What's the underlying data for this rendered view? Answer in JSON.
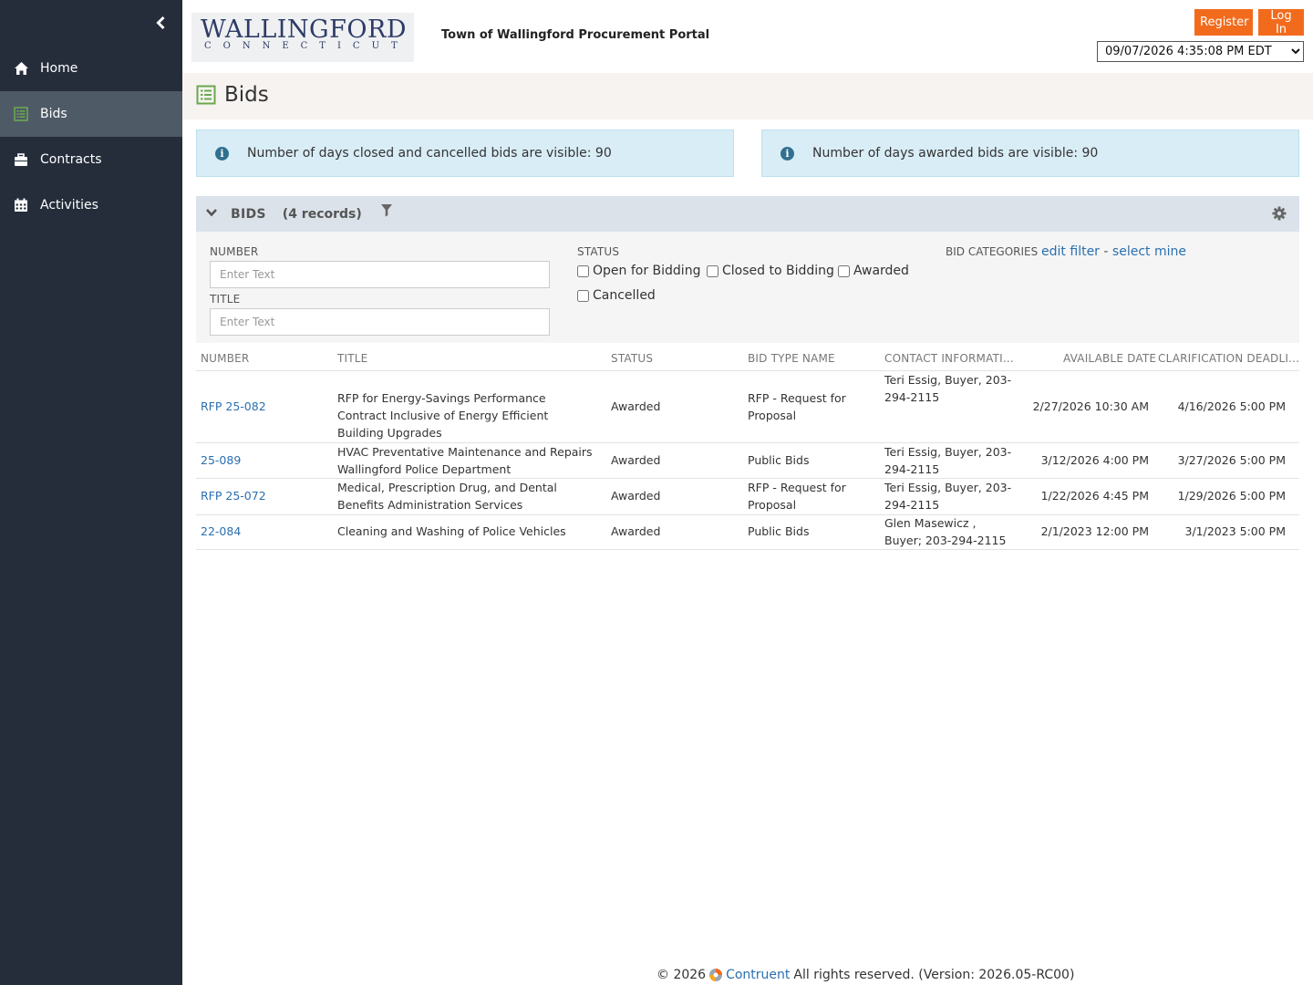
{
  "sidebar": {
    "items": [
      {
        "label": "Home",
        "icon": "home-icon"
      },
      {
        "label": "Bids",
        "icon": "list-icon",
        "active": true
      },
      {
        "label": "Contracts",
        "icon": "briefcase-icon"
      },
      {
        "label": "Activities",
        "icon": "calendar-icon"
      }
    ]
  },
  "header": {
    "logo_main": "WALLINGFORD",
    "logo_sub": "CONNECTICUT",
    "portal_title": "Town of Wallingford Procurement Portal",
    "register_label": "Register",
    "login_label": "Log In",
    "datetime": "09/07/2026 4:35:08 PM  EDT"
  },
  "page": {
    "title": "Bids"
  },
  "info": {
    "closed_cancelled": "Number of days closed and cancelled bids are visible: 90",
    "awarded": "Number of days awarded bids are visible: 90"
  },
  "panel": {
    "label": "BIDS",
    "count": "(4 records)"
  },
  "filters": {
    "number_label": "NUMBER",
    "number_placeholder": "Enter Text",
    "title_label": "TITLE",
    "title_placeholder": "Enter Text",
    "status_label": "STATUS",
    "status_options": [
      "Open for Bidding",
      "Closed to Bidding",
      "Awarded",
      "Cancelled"
    ],
    "bid_categories_label": "BID CATEGORIES",
    "edit_filter": "edit filter",
    "separator": " - ",
    "select_mine": "select mine"
  },
  "table": {
    "headers": [
      "NUMBER",
      "TITLE",
      "STATUS",
      "BID TYPE NAME",
      "CONTACT INFORMATI...",
      "AVAILABLE DATE",
      "CLARIFICATION DEADLI..."
    ],
    "rows": [
      {
        "number": "RFP 25-082",
        "title": "RFP for Energy-Savings Performance Contract Inclusive of Energy Efficient Building Upgrades",
        "status": "Awarded",
        "bid_type": "RFP - Request for Proposal",
        "contact": "Teri Essig, Buyer, 203-294-2115",
        "available": "2/27/2026 10:30 AM",
        "clarification": "4/16/2026 5:00 PM"
      },
      {
        "number": "25-089",
        "title": "HVAC Preventative Maintenance and Repairs Wallingford Police Department",
        "status": "Awarded",
        "bid_type": "Public Bids",
        "contact": "Teri Essig, Buyer, 203-294-2115",
        "available": "3/12/2026 4:00 PM",
        "clarification": "3/27/2026 5:00 PM"
      },
      {
        "number": "RFP 25-072",
        "title": "Medical, Prescription Drug, and Dental Benefits Administration Services",
        "status": "Awarded",
        "bid_type": "RFP - Request for Proposal",
        "contact": "Teri Essig, Buyer, 203-294-2115",
        "available": "1/22/2026 4:45 PM",
        "clarification": "1/29/2026 5:00 PM"
      },
      {
        "number": "22-084",
        "title": "Cleaning and Washing of Police Vehicles",
        "status": "Awarded",
        "bid_type": "Public Bids",
        "contact": "Glen Masewicz , Buyer; 203-294-2115",
        "available": "2/1/2023 12:00 PM",
        "clarification": "3/1/2023 5:00 PM"
      }
    ]
  },
  "footer": {
    "copyright": "© 2026",
    "brand": "Contruent",
    "rest": "All rights reserved. (Version: 2026.05-RC00)"
  },
  "colors": {
    "sidebar_bg": "#252d3b",
    "sidebar_active": "#4f5a67",
    "accent_orange": "#f26b1d",
    "link_blue": "#2a6fb0",
    "info_bg": "#d9edf7",
    "bids_icon_green": "#6aa84f"
  }
}
